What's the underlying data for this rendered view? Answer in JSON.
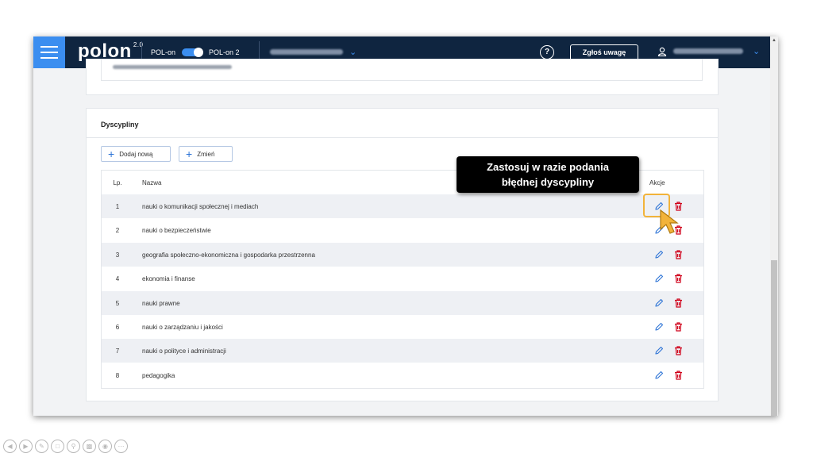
{
  "header": {
    "logo_text": "polon",
    "logo_version": "2.0",
    "toggle_left": "POL-on",
    "toggle_right": "POL-on 2",
    "help_symbol": "?",
    "report_button": "Zgłoś uwagę"
  },
  "section": {
    "title": "Dyscypliny",
    "add_button": "Dodaj nową",
    "change_button": "Zmień"
  },
  "table": {
    "headers": {
      "lp": "Lp.",
      "name": "Nazwa",
      "actions": "Akcje"
    },
    "rows": [
      {
        "lp": "1",
        "name": "nauki o komunikacji społecznej i mediach"
      },
      {
        "lp": "2",
        "name": "nauki o bezpieczeństwie"
      },
      {
        "lp": "3",
        "name": "geografia społeczno-ekonomiczna i gospodarka przestrzenna"
      },
      {
        "lp": "4",
        "name": "ekonomia i finanse"
      },
      {
        "lp": "5",
        "name": "nauki prawne"
      },
      {
        "lp": "6",
        "name": "nauki o zarządzaniu i jakości"
      },
      {
        "lp": "7",
        "name": "nauki o polityce i administracji"
      },
      {
        "lp": "8",
        "name": "pedagogika"
      }
    ]
  },
  "callout": {
    "line1": "Zastosuj w razie podania",
    "line2": "błędnej dyscypliny"
  },
  "colors": {
    "topbar": "#0f2540",
    "accent": "#3b8ef0",
    "edit_icon": "#2d74d6",
    "delete_icon": "#d0021b",
    "highlight": "#f2b33a"
  },
  "icons": [
    "menu-icon",
    "help-icon",
    "user-icon",
    "chevron-down-icon",
    "plus-icon",
    "edit-icon",
    "delete-icon",
    "cursor-icon"
  ]
}
